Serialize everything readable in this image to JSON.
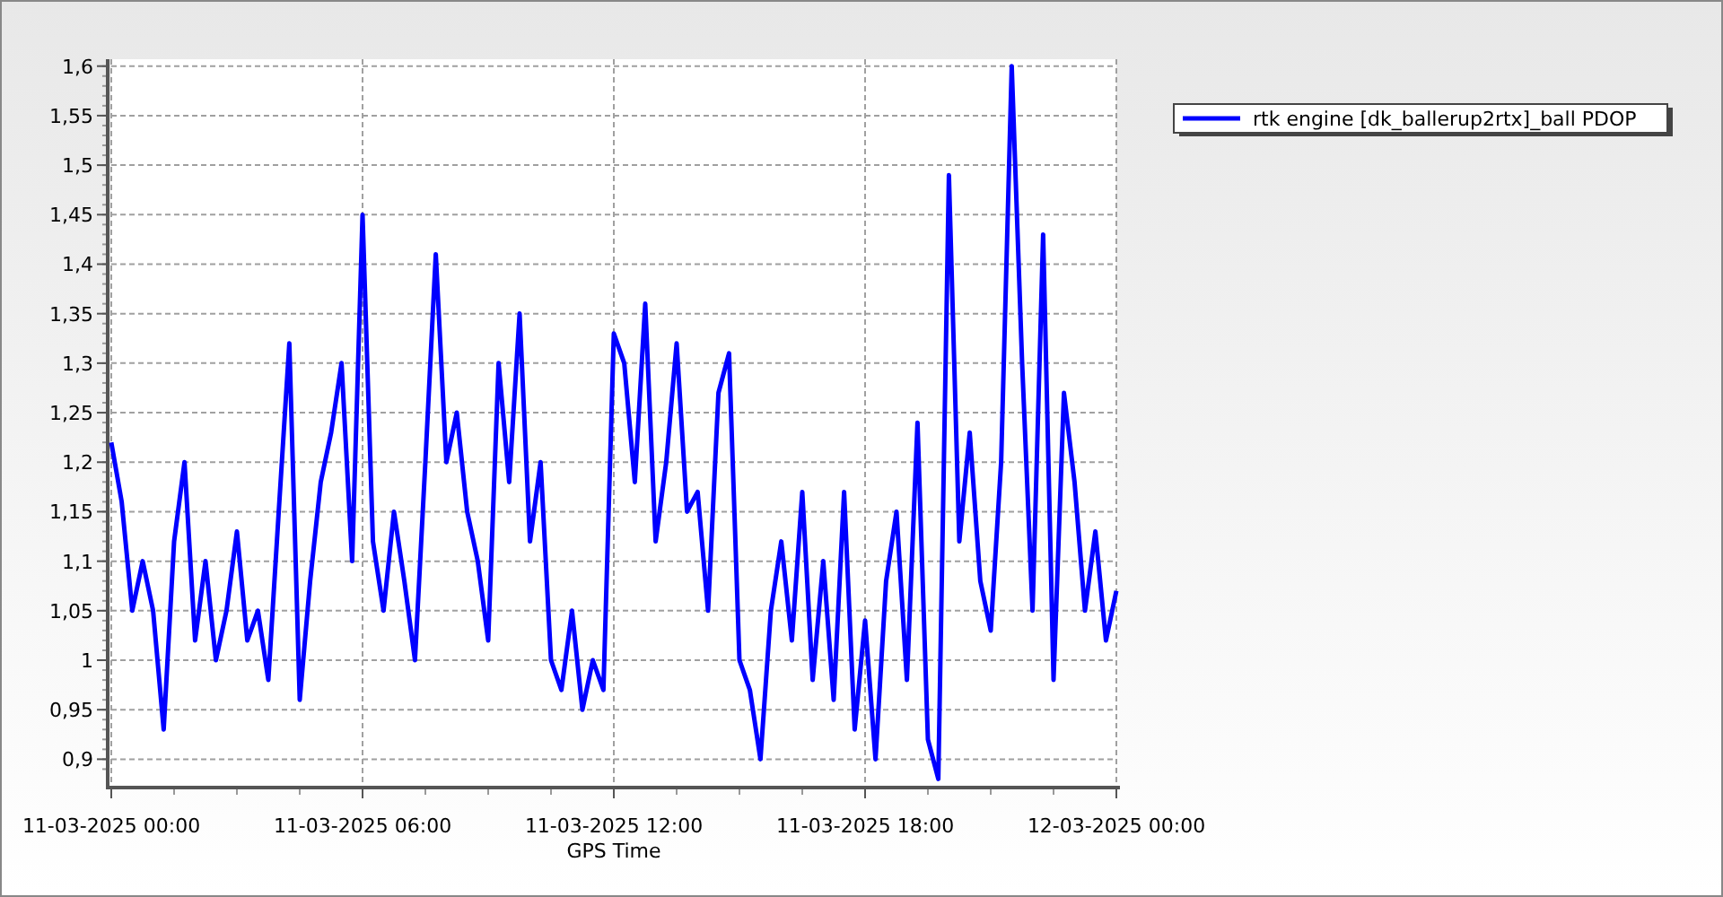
{
  "chart_data": {
    "type": "line",
    "xlabel": "GPS Time",
    "ylim": [
      0.875,
      1.607
    ],
    "grid": true,
    "yticks": [
      {
        "value": 0.9,
        "label": "0,9"
      },
      {
        "value": 0.95,
        "label": "0,95"
      },
      {
        "value": 1,
        "label": "1"
      },
      {
        "value": 1.05,
        "label": "1,05"
      },
      {
        "value": 1.1,
        "label": "1,1"
      },
      {
        "value": 1.15,
        "label": "1,15"
      },
      {
        "value": 1.2,
        "label": "1,2"
      },
      {
        "value": 1.25,
        "label": "1,25"
      },
      {
        "value": 1.3,
        "label": "1,3"
      },
      {
        "value": 1.35,
        "label": "1,35"
      },
      {
        "value": 1.4,
        "label": "1,4"
      },
      {
        "value": 1.45,
        "label": "1,45"
      },
      {
        "value": 1.5,
        "label": "1,5"
      },
      {
        "value": 1.55,
        "label": "1,55"
      },
      {
        "value": 1.6,
        "label": "1,6"
      }
    ],
    "categories": [
      "11-03-2025 00:00",
      null,
      null,
      null,
      null,
      null,
      null,
      null,
      null,
      null,
      null,
      null,
      null,
      null,
      null,
      null,
      null,
      null,
      null,
      null,
      null,
      null,
      null,
      null,
      "11-03-2025 06:00",
      null,
      null,
      null,
      null,
      null,
      null,
      null,
      null,
      null,
      null,
      null,
      null,
      null,
      null,
      null,
      null,
      null,
      null,
      null,
      null,
      null,
      null,
      null,
      "11-03-2025 12:00",
      null,
      null,
      null,
      null,
      null,
      null,
      null,
      null,
      null,
      null,
      null,
      null,
      null,
      null,
      null,
      null,
      null,
      null,
      null,
      null,
      null,
      null,
      null,
      "11-03-2025 18:00",
      null,
      null,
      null,
      null,
      null,
      null,
      null,
      null,
      null,
      null,
      null,
      null,
      null,
      null,
      null,
      null,
      null,
      null,
      null,
      null,
      null,
      null,
      null,
      "12-03-2025 00:00"
    ],
    "series": [
      {
        "name": "rtk engine [dk_ballerup2rtx]_ball PDOP",
        "color": "#0000ff",
        "values": [
          1.22,
          1.16,
          1.05,
          1.1,
          1.05,
          0.93,
          1.12,
          1.2,
          1.02,
          1.1,
          1,
          1.05,
          1.13,
          1.02,
          1.05,
          0.98,
          1.15,
          1.32,
          0.96,
          1.08,
          1.18,
          1.23,
          1.3,
          1.1,
          1.45,
          1.12,
          1.05,
          1.15,
          1.08,
          1,
          1.2,
          1.41,
          1.2,
          1.25,
          1.15,
          1.1,
          1.02,
          1.3,
          1.18,
          1.35,
          1.12,
          1.2,
          1,
          0.97,
          1.05,
          0.95,
          1,
          0.97,
          1.33,
          1.3,
          1.18,
          1.36,
          1.12,
          1.2,
          1.32,
          1.15,
          1.17,
          1.05,
          1.27,
          1.31,
          1,
          0.97,
          0.9,
          1.05,
          1.12,
          1.02,
          1.17,
          0.98,
          1.1,
          0.96,
          1.17,
          0.93,
          1.04,
          0.9,
          1.08,
          1.15,
          0.98,
          1.24,
          0.92,
          0.88,
          1.49,
          1.12,
          1.23,
          1.08,
          1.03,
          1.2,
          1.6,
          1.3,
          1.05,
          1.43,
          0.98,
          1.27,
          1.18,
          1.05,
          1.13,
          1.02,
          1.07
        ]
      }
    ]
  }
}
